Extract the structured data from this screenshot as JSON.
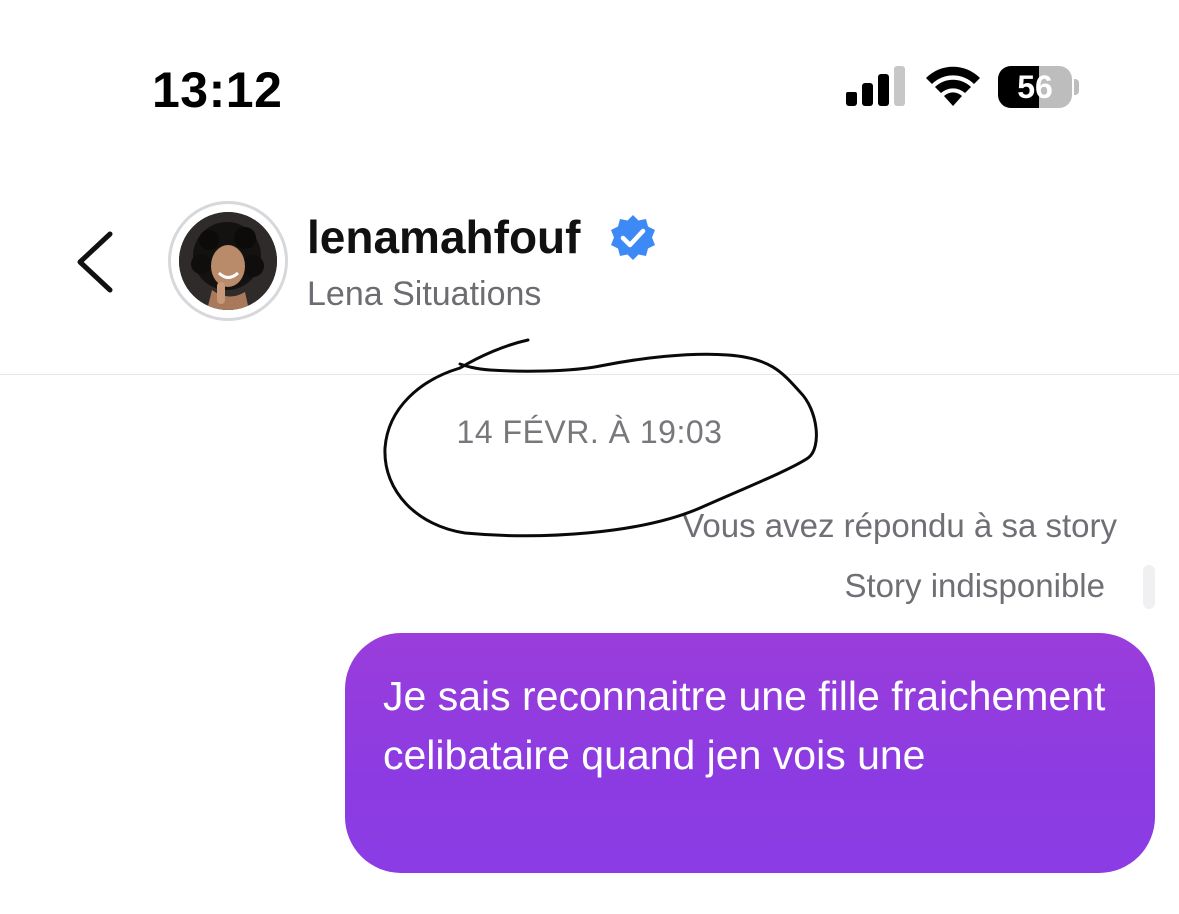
{
  "status_bar": {
    "time": "13:12",
    "battery": "56",
    "battery_level": 0.56,
    "icons": [
      "cellular-signal-icon",
      "wifi-icon",
      "battery-icon"
    ]
  },
  "header": {
    "back_icon": "chevron-left-icon",
    "username": "lenamahfouf",
    "verified_icon": "verified-badge-icon",
    "full_name": "Lena Situations"
  },
  "conversation": {
    "timestamp": "14 FÉVR. À 19:03",
    "reply_note": "Vous avez répondu à sa story",
    "story_status": "Story indisponible",
    "message": "Je sais reconnaitre une fille fraichement celibataire quand jen vois une"
  },
  "colors": {
    "bubble_purple": "#8f3be0",
    "verified_blue": "#3d8af7",
    "secondary_text": "#6f6f75"
  }
}
